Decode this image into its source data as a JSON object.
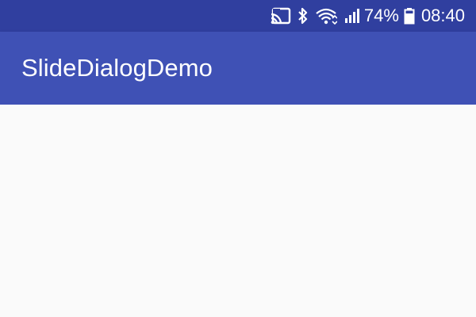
{
  "status_bar": {
    "icons": [
      "cast-icon",
      "bluetooth-icon",
      "wifi-icon",
      "signal-icon",
      "battery-icon"
    ],
    "battery_percent": "74%",
    "time": "08:40",
    "color": "#303F9F"
  },
  "app_bar": {
    "title": "SlideDialogDemo",
    "color": "#3F51B5"
  },
  "content": {
    "background": "#FAFAFA"
  }
}
